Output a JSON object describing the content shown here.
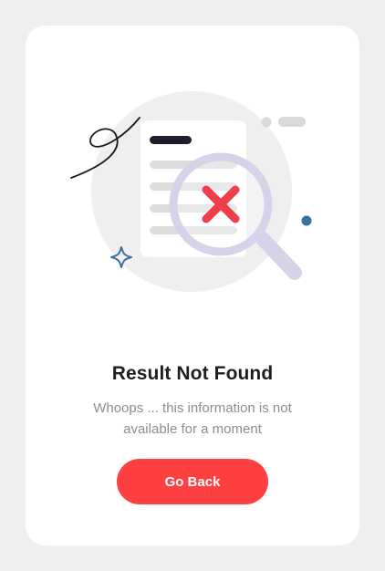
{
  "dialog": {
    "title": "Result Not Found",
    "message": "Whoops ... this information is not available for a moment",
    "button_label": "Go Back"
  },
  "colors": {
    "accent": "#ff4040",
    "title": "#1e1e1e",
    "message": "#8d8d8d",
    "background": "#efefef",
    "card": "#ffffff",
    "error_x": "#ef3e4a",
    "decor_blue": "#3b6fa0"
  },
  "illustration": {
    "icons": [
      "document-icon",
      "magnifier-icon",
      "error-x-icon",
      "sparkle-icon",
      "squiggle-line",
      "dot-decoration"
    ]
  }
}
